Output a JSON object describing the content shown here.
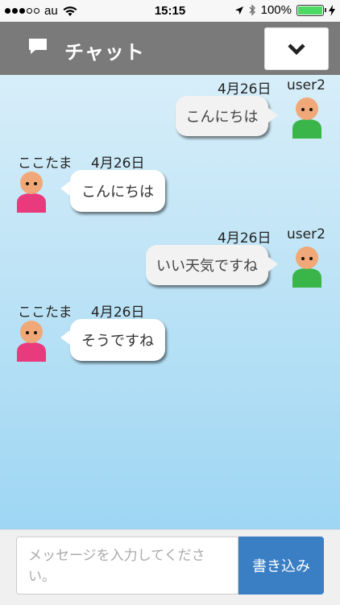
{
  "status_bar": {
    "carrier": "au",
    "time": "15:15",
    "battery": "100%",
    "battery_level": 1.0
  },
  "header": {
    "title": "チャット"
  },
  "messages": [
    {
      "side": "right",
      "user": "user2",
      "date": "4月26日",
      "text": "こんにちは"
    },
    {
      "side": "left",
      "user": "ここたま",
      "date": "4月26日",
      "text": "こんにちは"
    },
    {
      "side": "right",
      "user": "user2",
      "date": "4月26日",
      "text": "いい天気ですね"
    },
    {
      "side": "left",
      "user": "ここたま",
      "date": "4月26日",
      "text": "そうですね"
    }
  ],
  "composer": {
    "placeholder": "メッセージを入力してください。",
    "send_label": "書き込み"
  },
  "colors": {
    "header_bg": "#7a7a7a",
    "send_button": "#3a7ec4",
    "self_avatar": "#3ab54a",
    "other_avatar": "#e83a7c"
  }
}
